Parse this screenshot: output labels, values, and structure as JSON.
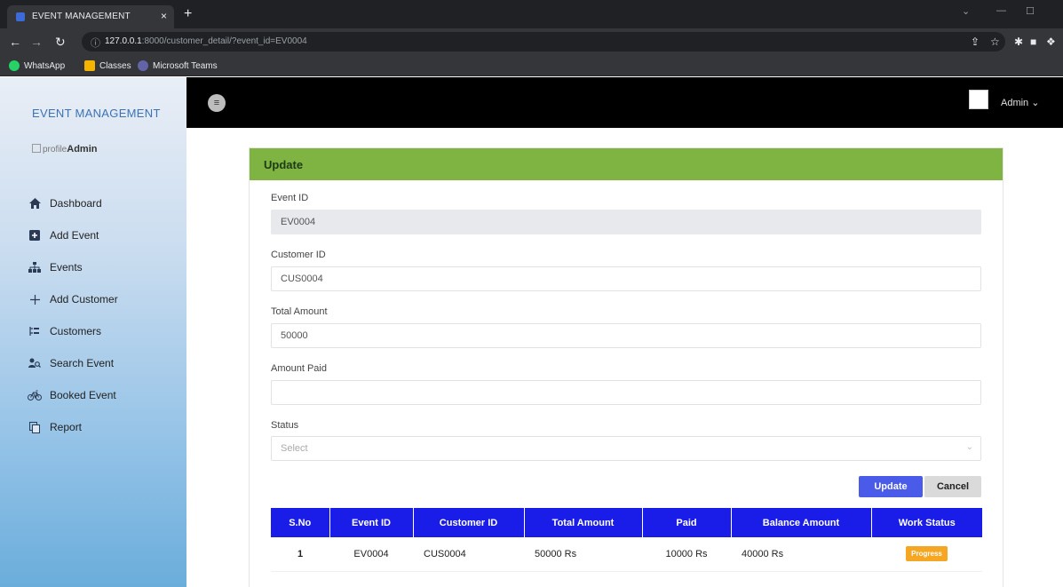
{
  "browser": {
    "tab_title": "EVENT MANAGEMENT",
    "tab_close": "×",
    "new_tab": "+",
    "url_host": "127.0.0.1",
    "url_rest": ":8000/customer_detail/?event_id=EV0004",
    "bookmarks": [
      "WhatsApp",
      "Classes",
      "Microsoft Teams"
    ]
  },
  "sidebar": {
    "brand": "EVENT MANAGEMENT",
    "profile_alt": "profile",
    "profile_name": "Admin",
    "items": [
      {
        "label": "Dashboard",
        "icon": "home-icon"
      },
      {
        "label": "Add Event",
        "icon": "plus-square-icon"
      },
      {
        "label": "Events",
        "icon": "sitemap-icon"
      },
      {
        "label": "Add Customer",
        "icon": "plus-icon"
      },
      {
        "label": "Customers",
        "icon": "list-tree-icon"
      },
      {
        "label": "Search Event",
        "icon": "user-search-icon"
      },
      {
        "label": "Booked Event",
        "icon": "bicycle-icon"
      },
      {
        "label": "Report",
        "icon": "copy-icon"
      }
    ]
  },
  "header": {
    "menu_glyph": "≡",
    "user": "Admin"
  },
  "form": {
    "title": "Update",
    "event_id_label": "Event ID",
    "event_id_value": "EV0004",
    "customer_id_label": "Customer ID",
    "customer_id_value": "CUS0004",
    "total_amount_label": "Total Amount",
    "total_amount_value": "50000",
    "amount_paid_label": "Amount Paid",
    "amount_paid_value": "",
    "status_label": "Status",
    "status_selected": "Select",
    "update_label": "Update",
    "cancel_label": "Cancel"
  },
  "table": {
    "headers": [
      "S.No",
      "Event ID",
      "Customer ID",
      "Total Amount",
      "Paid",
      "Balance Amount",
      "Work Status"
    ],
    "rows": [
      [
        "1",
        "EV0004",
        "CUS0004",
        "50000 Rs",
        "10000 Rs",
        "40000 Rs",
        "Progress"
      ]
    ]
  },
  "colors": {
    "card_header": "#7fb342",
    "table_header": "#1a1de8",
    "primary_button": "#4a5bea",
    "badge": "#f5a623"
  }
}
